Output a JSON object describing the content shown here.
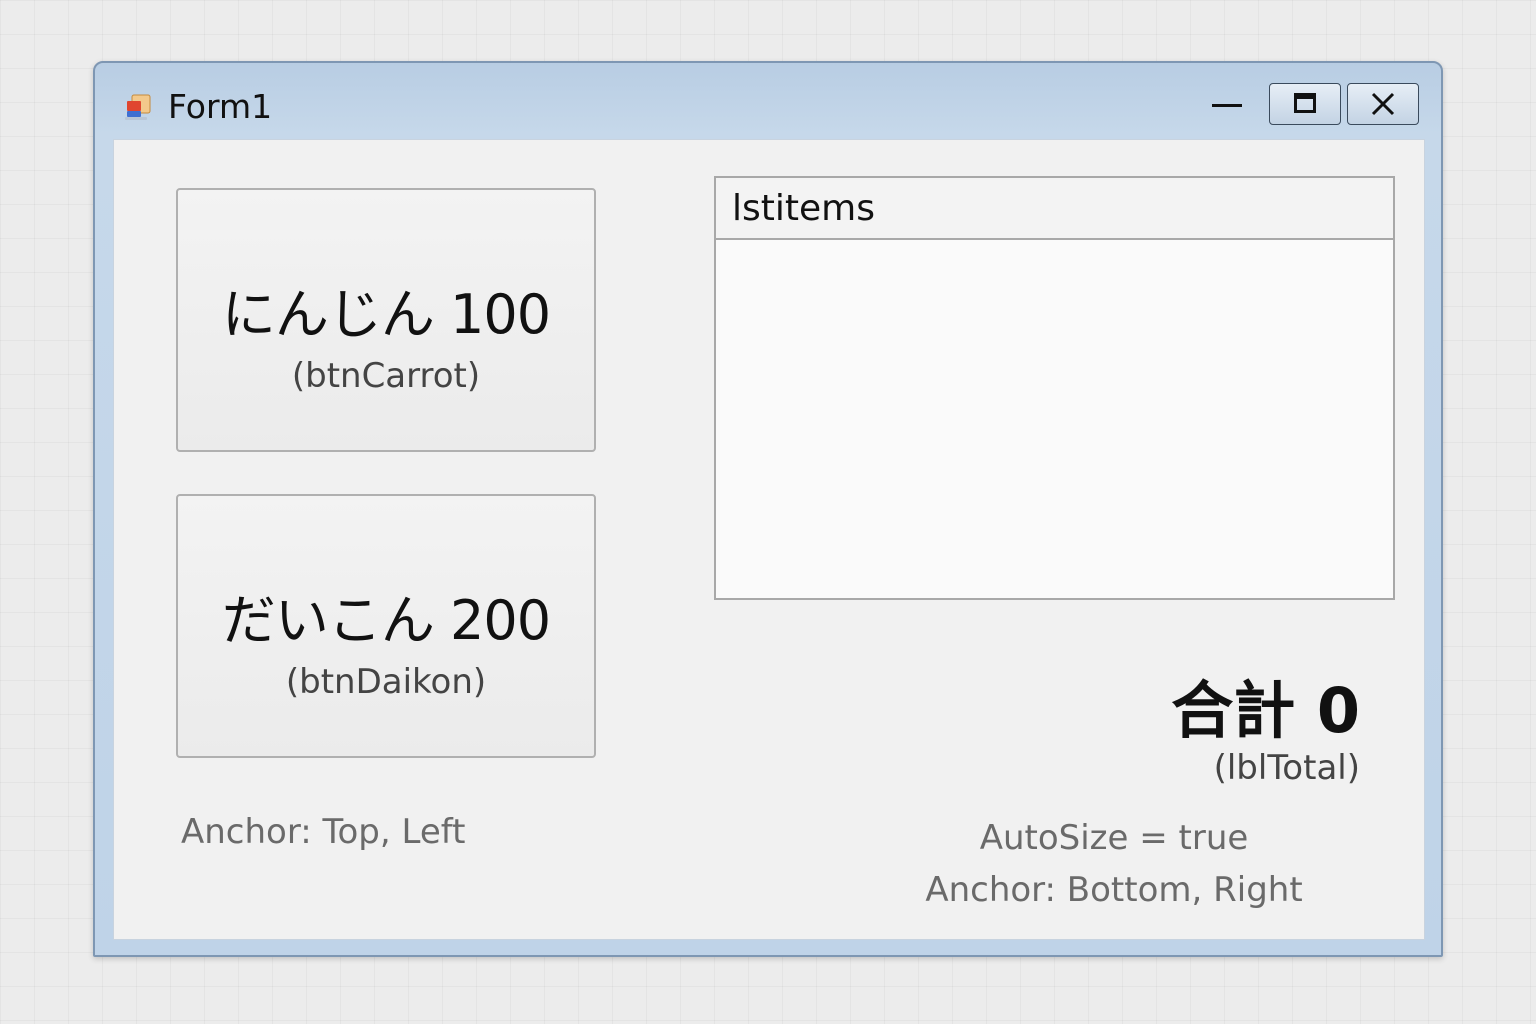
{
  "window": {
    "title": "Form1",
    "icon": "form-app-icon",
    "controls": {
      "minimize": "minimize-icon",
      "maximize": "maximize-icon",
      "close": "close-icon"
    }
  },
  "buttons": [
    {
      "label": "にんじん 100",
      "name": "(btnCarrot)"
    },
    {
      "label": "だいこん 200",
      "name": "(btnDaikon)"
    }
  ],
  "listbox": {
    "header": "lstitems",
    "items": []
  },
  "total": {
    "text": "合計 0",
    "name": "(lblTotal)"
  },
  "notes": {
    "left": "Anchor: Top, Left",
    "right_line1": "AutoSize = true",
    "right_line2": "Anchor: Bottom, Right"
  }
}
